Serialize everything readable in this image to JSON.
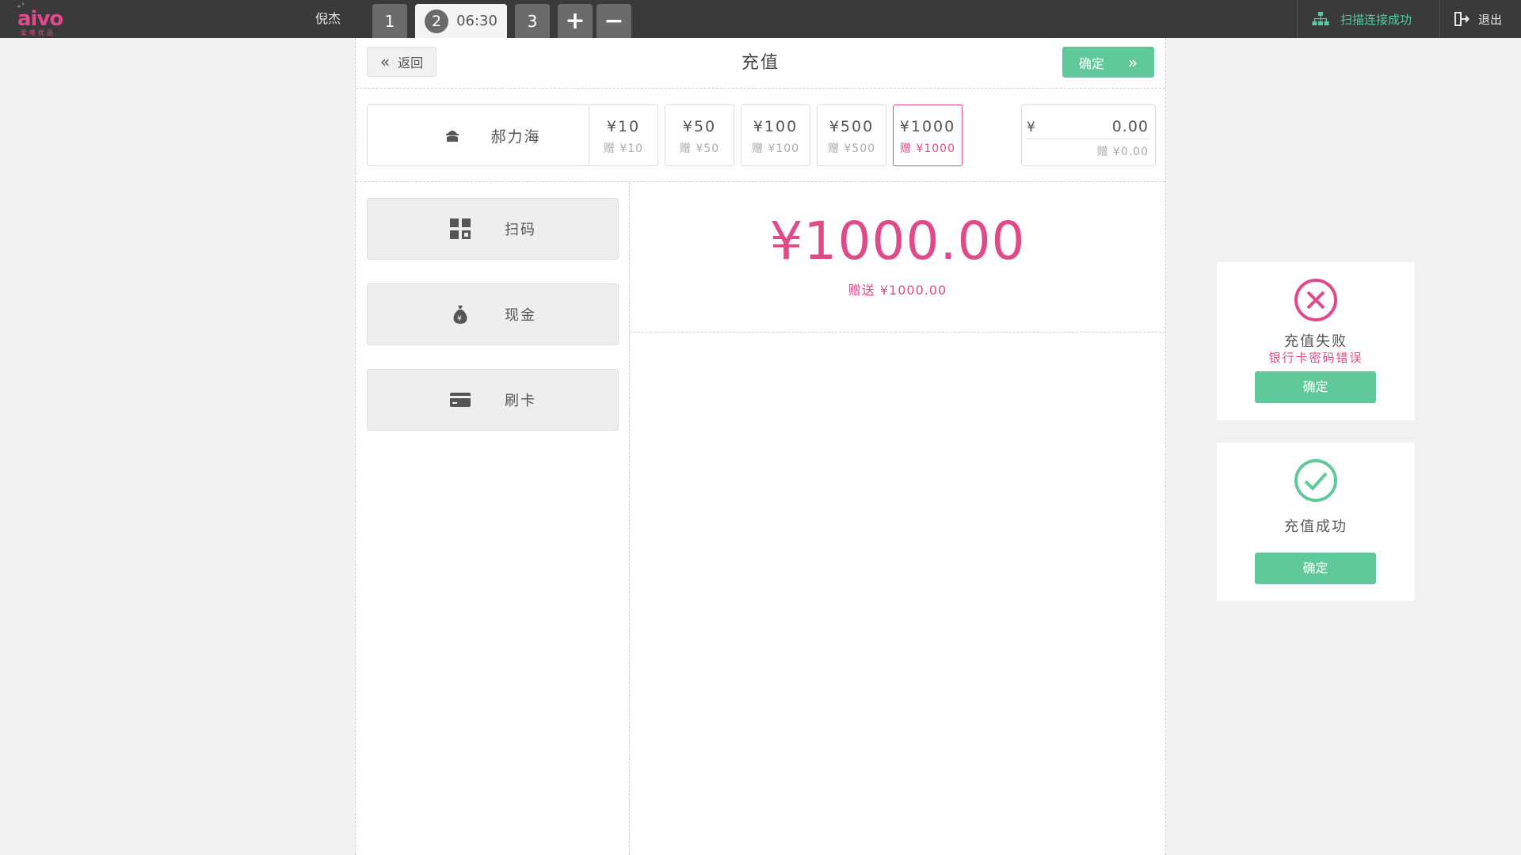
{
  "app": {
    "logo_text": "aivo",
    "logo_subtext": "爱唯优品",
    "username": "倪杰"
  },
  "tabs": [
    {
      "label": "1"
    },
    {
      "label": "2",
      "time": "06:30",
      "active": true
    },
    {
      "label": "3"
    }
  ],
  "tab_controls": {
    "add_label": "+",
    "remove_label": "−"
  },
  "status": {
    "scan_label": "扫描连接成功",
    "logout_label": "退出"
  },
  "header": {
    "back_label": "返回",
    "title": "充值",
    "confirm_label": "确定"
  },
  "member": {
    "name": "郝力海"
  },
  "amounts": [
    {
      "label": "¥10",
      "bonus": "赠 ¥10",
      "selected": false
    },
    {
      "label": "¥50",
      "bonus": "赠 ¥50",
      "selected": false
    },
    {
      "label": "¥100",
      "bonus": "赠 ¥100",
      "selected": false
    },
    {
      "label": "¥500",
      "bonus": "赠 ¥500",
      "selected": false
    },
    {
      "label": "¥1000",
      "bonus": "赠 ¥1000",
      "selected": true
    }
  ],
  "custom_amount": {
    "currency": "¥",
    "value": "0.00",
    "bonus": "赠 ¥0.00"
  },
  "payment_methods": [
    {
      "label": "扫码",
      "icon": "qr-grid-icon"
    },
    {
      "label": "现金",
      "icon": "money-bag-icon"
    },
    {
      "label": "刷卡",
      "icon": "card-icon"
    }
  ],
  "display": {
    "amount": "¥1000.00",
    "bonus_text": "赠送 ¥1000.00"
  },
  "dialogs": {
    "fail": {
      "title": "充值失败",
      "subtitle": "银行卡密码错误",
      "button": "确定"
    },
    "success": {
      "title": "充值成功",
      "button": "确定"
    }
  },
  "colors": {
    "topbar": "#3a3a3a",
    "accent_pink": "#e0498a",
    "accent_green": "#5fc99a",
    "status_green": "#4fcf9f",
    "background": "#f2f1f2"
  }
}
